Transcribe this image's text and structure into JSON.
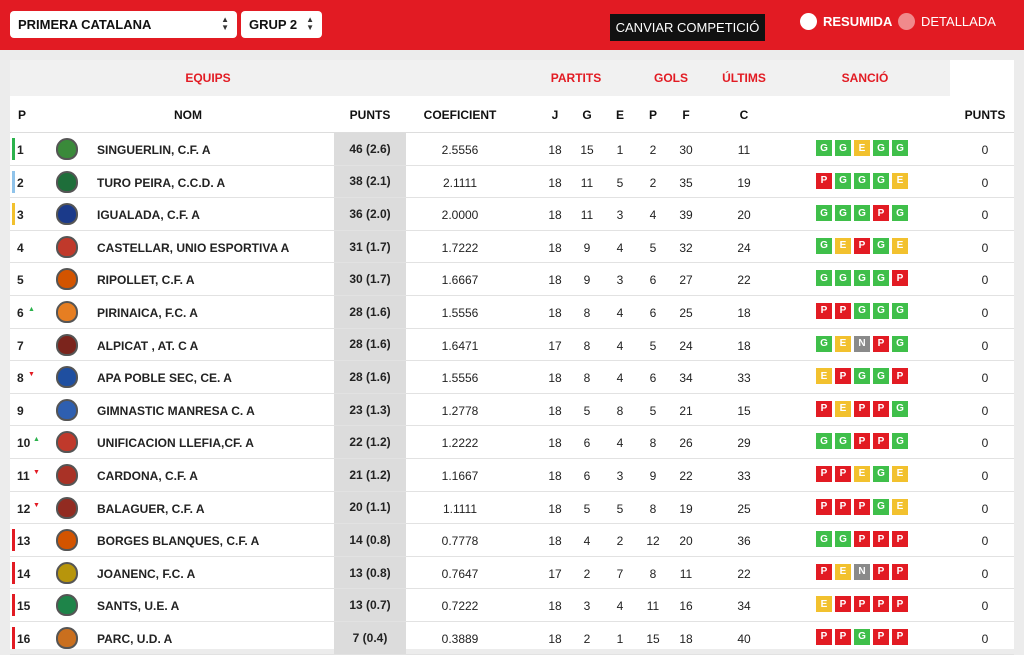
{
  "topbar": {
    "competition": "PRIMERA CATALANA",
    "group": "GRUP 2",
    "change_button": "CANVIAR COMPETICIÓ",
    "radio_summary": "RESUMIDA",
    "radio_detail": "DETALLADA"
  },
  "headers": {
    "equips": "EQUIPS",
    "partits": "PARTITS",
    "gols": "GOLS",
    "ultims": "ÚLTIMS",
    "sancio": "SANCIÓ",
    "p": "P",
    "nom": "NOM",
    "punts": "PUNTS",
    "coeficient": "COEFICIENT",
    "j": "J",
    "g": "G",
    "e": "E",
    "pp": "P",
    "f": "F",
    "c": "C",
    "punts_sancio": "PUNTS"
  },
  "colors": {
    "accent": "#e21b23",
    "win": "#3fbf4a",
    "draw": "#f2c12e",
    "loss": "#e21b23",
    "none": "#8a8a8a"
  },
  "rows": [
    {
      "pos": "1",
      "trend": "",
      "zone": "#2bb24c",
      "crest": "#3a8a3a",
      "name": "SINGUERLIN, C.F. A",
      "punts": "46 (2.6)",
      "coef": "2.5556",
      "j": "18",
      "g": "15",
      "e": "1",
      "p": "2",
      "f": "30",
      "c": "11",
      "last": [
        "G",
        "G",
        "E",
        "G",
        "G"
      ],
      "sancio": "0"
    },
    {
      "pos": "2",
      "trend": "",
      "zone": "#8fc3ea",
      "crest": "#1e6e3a",
      "name": "TURO PEIRA, C.C.D. A",
      "punts": "38 (2.1)",
      "coef": "2.1111",
      "j": "18",
      "g": "11",
      "e": "5",
      "p": "2",
      "f": "35",
      "c": "19",
      "last": [
        "P",
        "G",
        "G",
        "G",
        "E"
      ],
      "sancio": "0"
    },
    {
      "pos": "3",
      "trend": "",
      "zone": "#f2c12e",
      "crest": "#1b3a8a",
      "name": "IGUALADA, C.F. A",
      "punts": "36 (2.0)",
      "coef": "2.0000",
      "j": "18",
      "g": "11",
      "e": "3",
      "p": "4",
      "f": "39",
      "c": "20",
      "last": [
        "G",
        "G",
        "G",
        "P",
        "G"
      ],
      "sancio": "0"
    },
    {
      "pos": "4",
      "trend": "",
      "zone": "",
      "crest": "#c0392b",
      "name": "CASTELLAR, UNIO ESPORTIVA A",
      "punts": "31 (1.7)",
      "coef": "1.7222",
      "j": "18",
      "g": "9",
      "e": "4",
      "p": "5",
      "f": "32",
      "c": "24",
      "last": [
        "G",
        "E",
        "P",
        "G",
        "E"
      ],
      "sancio": "0"
    },
    {
      "pos": "5",
      "trend": "",
      "zone": "",
      "crest": "#d35400",
      "name": "RIPOLLET, C.F. A",
      "punts": "30 (1.7)",
      "coef": "1.6667",
      "j": "18",
      "g": "9",
      "e": "3",
      "p": "6",
      "f": "27",
      "c": "22",
      "last": [
        "G",
        "G",
        "G",
        "G",
        "P"
      ],
      "sancio": "0"
    },
    {
      "pos": "6",
      "trend": "up",
      "zone": "",
      "crest": "#e67e22",
      "name": "PIRINAICA, F.C. A",
      "punts": "28 (1.6)",
      "coef": "1.5556",
      "j": "18",
      "g": "8",
      "e": "4",
      "p": "6",
      "f": "25",
      "c": "18",
      "last": [
        "P",
        "P",
        "G",
        "G",
        "G"
      ],
      "sancio": "0"
    },
    {
      "pos": "7",
      "trend": "",
      "zone": "",
      "crest": "#7b241c",
      "name": "ALPICAT , AT. C A",
      "punts": "28 (1.6)",
      "coef": "1.6471",
      "j": "17",
      "g": "8",
      "e": "4",
      "p": "5",
      "f": "24",
      "c": "18",
      "last": [
        "G",
        "E",
        "N",
        "P",
        "G"
      ],
      "sancio": "0"
    },
    {
      "pos": "8",
      "trend": "down",
      "zone": "",
      "crest": "#1f4fa0",
      "name": "APA POBLE SEC, CE. A",
      "punts": "28 (1.6)",
      "coef": "1.5556",
      "j": "18",
      "g": "8",
      "e": "4",
      "p": "6",
      "f": "34",
      "c": "33",
      "last": [
        "E",
        "P",
        "G",
        "G",
        "P"
      ],
      "sancio": "0"
    },
    {
      "pos": "9",
      "trend": "",
      "zone": "",
      "crest": "#2e5fb0",
      "name": "GIMNASTIC MANRESA C. A",
      "punts": "23 (1.3)",
      "coef": "1.2778",
      "j": "18",
      "g": "5",
      "e": "8",
      "p": "5",
      "f": "21",
      "c": "15",
      "last": [
        "P",
        "E",
        "P",
        "P",
        "G"
      ],
      "sancio": "0"
    },
    {
      "pos": "10",
      "trend": "up",
      "zone": "",
      "crest": "#c0392b",
      "name": "UNIFICACION LLEFIA,CF. A",
      "punts": "22 (1.2)",
      "coef": "1.2222",
      "j": "18",
      "g": "6",
      "e": "4",
      "p": "8",
      "f": "26",
      "c": "29",
      "last": [
        "G",
        "G",
        "P",
        "P",
        "G"
      ],
      "sancio": "0"
    },
    {
      "pos": "11",
      "trend": "down",
      "zone": "",
      "crest": "#a93226",
      "name": "CARDONA, C.F. A",
      "punts": "21 (1.2)",
      "coef": "1.1667",
      "j": "18",
      "g": "6",
      "e": "3",
      "p": "9",
      "f": "22",
      "c": "33",
      "last": [
        "P",
        "P",
        "E",
        "G",
        "E"
      ],
      "sancio": "0"
    },
    {
      "pos": "12",
      "trend": "down",
      "zone": "",
      "crest": "#922b21",
      "name": "BALAGUER, C.F. A",
      "punts": "20 (1.1)",
      "coef": "1.1111",
      "j": "18",
      "g": "5",
      "e": "5",
      "p": "8",
      "f": "19",
      "c": "25",
      "last": [
        "P",
        "P",
        "P",
        "G",
        "E"
      ],
      "sancio": "0"
    },
    {
      "pos": "13",
      "trend": "",
      "zone": "#e21b23",
      "crest": "#d35400",
      "name": "BORGES BLANQUES, C.F. A",
      "punts": "14 (0.8)",
      "coef": "0.7778",
      "j": "18",
      "g": "4",
      "e": "2",
      "p": "12",
      "f": "20",
      "c": "36",
      "last": [
        "G",
        "G",
        "P",
        "P",
        "P"
      ],
      "sancio": "0"
    },
    {
      "pos": "14",
      "trend": "",
      "zone": "#e21b23",
      "crest": "#b7950b",
      "name": "JOANENC, F.C. A",
      "punts": "13 (0.8)",
      "coef": "0.7647",
      "j": "17",
      "g": "2",
      "e": "7",
      "p": "8",
      "f": "11",
      "c": "22",
      "last": [
        "P",
        "E",
        "N",
        "P",
        "P"
      ],
      "sancio": "0"
    },
    {
      "pos": "15",
      "trend": "",
      "zone": "#e21b23",
      "crest": "#1e8449",
      "name": "SANTS, U.E. A",
      "punts": "13 (0.7)",
      "coef": "0.7222",
      "j": "18",
      "g": "3",
      "e": "4",
      "p": "11",
      "f": "16",
      "c": "34",
      "last": [
        "E",
        "P",
        "P",
        "P",
        "P"
      ],
      "sancio": "0"
    },
    {
      "pos": "16",
      "trend": "",
      "zone": "#e21b23",
      "crest": "#ca6f1e",
      "name": "PARC, U.D. A",
      "punts": "7 (0.4)",
      "coef": "0.3889",
      "j": "18",
      "g": "2",
      "e": "1",
      "p": "15",
      "f": "18",
      "c": "40",
      "last": [
        "P",
        "P",
        "G",
        "P",
        "P"
      ],
      "sancio": "0"
    }
  ]
}
